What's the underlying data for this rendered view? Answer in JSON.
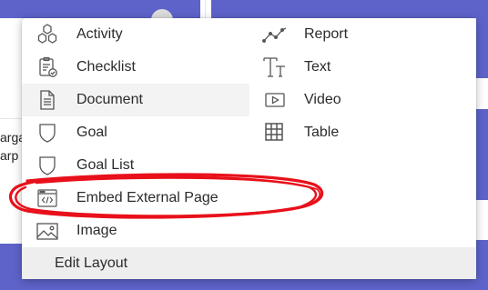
{
  "background": {
    "left_text_lines": [
      "arga",
      "arp"
    ]
  },
  "menu": {
    "left_items": [
      {
        "label": "Activity",
        "icon": "hexagons-icon"
      },
      {
        "label": "Checklist",
        "icon": "clipboard-check-icon"
      },
      {
        "label": "Document",
        "icon": "document-icon"
      },
      {
        "label": "Goal",
        "icon": "shield-icon"
      },
      {
        "label": "Goal List",
        "icon": "shield-icon"
      },
      {
        "label": "Embed External Page",
        "icon": "code-window-icon"
      },
      {
        "label": "Image",
        "icon": "image-icon"
      }
    ],
    "right_items": [
      {
        "label": "Report",
        "icon": "line-chart-icon"
      },
      {
        "label": "Text",
        "icon": "text-icon"
      },
      {
        "label": "Video",
        "icon": "play-icon"
      },
      {
        "label": "Table",
        "icon": "grid-table-icon"
      }
    ],
    "highlighted_item": "Document",
    "footer_label": "Edit Layout"
  },
  "colors": {
    "background_accent": "#5d63c9",
    "annotation_red": "#e8101a"
  }
}
